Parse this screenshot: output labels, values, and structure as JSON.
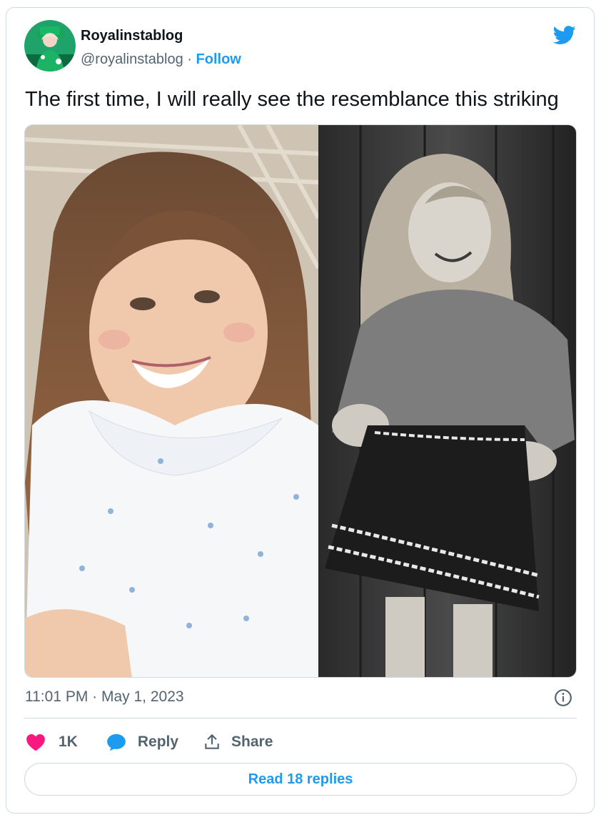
{
  "user": {
    "display_name": "Royalinstablog",
    "handle": "@royalinstablog",
    "separator": "·",
    "follow_label": "Follow"
  },
  "tweet": {
    "text": "The first time, I will really see the resemblance this striking",
    "timestamp": "11:01 PM · May 1, 2023"
  },
  "actions": {
    "like_count": "1K",
    "reply_label": "Reply",
    "share_label": "Share"
  },
  "footer": {
    "read_replies_label": "Read 18 replies"
  },
  "colors": {
    "accent": "#1d9bf0",
    "like": "#f91880",
    "text": "#0f1419",
    "muted": "#536471",
    "border": "#cfd9de"
  },
  "icons": [
    "twitter-bird-icon",
    "info-icon",
    "heart-icon",
    "reply-bubble-icon",
    "share-icon"
  ]
}
